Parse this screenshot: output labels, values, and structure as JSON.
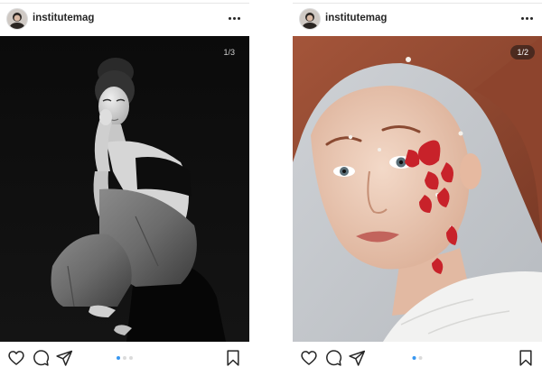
{
  "posts": [
    {
      "username": "institutemag",
      "counter": "1/3",
      "carousel_total": 3,
      "carousel_active": 1,
      "image": "black-and-white-fashion-portrait"
    },
    {
      "username": "institutemag",
      "counter": "1/2",
      "carousel_total": 2,
      "carousel_active": 1,
      "image": "beauty-portrait-with-red-petals"
    }
  ],
  "icons": [
    "more-icon",
    "heart-icon",
    "comment-icon",
    "share-icon",
    "bookmark-icon"
  ],
  "colors": {
    "text": "#262626",
    "dot_active": "#3897f0",
    "dot_inactive": "#dbdbdb",
    "petal": "#c8222a"
  }
}
